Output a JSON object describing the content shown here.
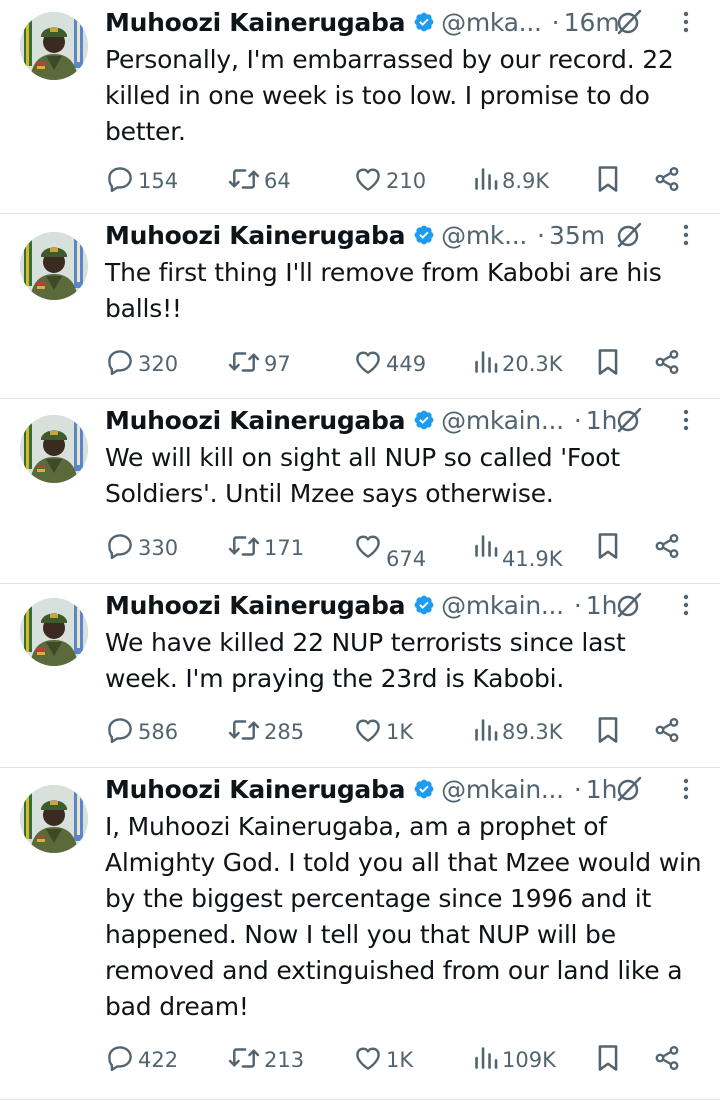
{
  "author": {
    "name": "Muhoozi Kainerugaba"
  },
  "tweets": [
    {
      "handle": "@mka...",
      "time": "16m",
      "text": "Personally, I'm embarrassed by our record. 22 killed in one week is too low. I promise to do better.",
      "replies": "154",
      "reposts": "64",
      "likes": "210",
      "views": "8.9K"
    },
    {
      "handle": "@mk...",
      "time": "35m",
      "text": "The first thing I'll remove from Kabobi are his balls!!",
      "replies": "320",
      "reposts": "97",
      "likes": "449",
      "views": "20.3K"
    },
    {
      "handle": "@mkain...",
      "time": "1h",
      "text": "We will kill on sight all NUP so called 'Foot Soldiers'. Until Mzee says otherwise.",
      "replies": "330",
      "reposts": "171",
      "likes": "674",
      "views": "41.9K"
    },
    {
      "handle": "@mkain...",
      "time": "1h",
      "text": "We have killed 22 NUP terrorists since last week. I'm praying the 23rd is Kabobi.",
      "replies": "586",
      "reposts": "285",
      "likes": "1K",
      "views": "89.3K"
    },
    {
      "handle": "@mkain...",
      "time": "1h",
      "text": "I, Muhoozi Kainerugaba, am a prophet of Almighty God. I told you all that Mzee would win by the biggest percentage since 1996 and it happened. Now I tell you that NUP will be removed and extinguished from our land like a bad dream!",
      "replies": "422",
      "reposts": "213",
      "likes": "1K",
      "views": "109K"
    }
  ],
  "colors": {
    "text": "#0f1419",
    "secondary": "#536471",
    "verified": "#1d9bf0",
    "divider": "#e1e5e9"
  },
  "icons": [
    "verified-badge-icon",
    "grok-icon",
    "more-icon",
    "reply-icon",
    "repost-icon",
    "like-icon",
    "views-icon",
    "bookmark-icon",
    "share-icon"
  ]
}
